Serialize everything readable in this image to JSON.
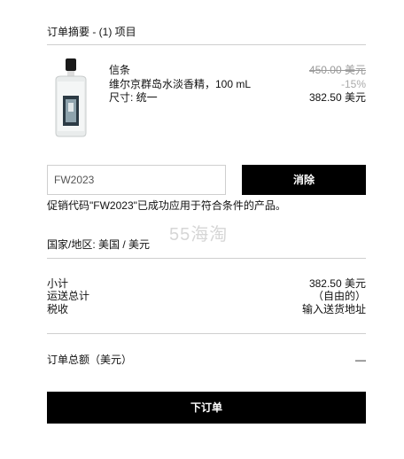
{
  "summary": {
    "title": "订单摘要 - (1) 项目"
  },
  "item": {
    "name": "信条",
    "description": "维尔京群岛水淡香精，100 mL",
    "size": "尺寸: 统一",
    "original_price": "450.00 美元",
    "discount": "-15%",
    "final_price": "382.50 美元"
  },
  "promo": {
    "code_value": "FW2023",
    "remove_label": "消除",
    "success_message": "促销代码\"FW2023\"已成功应用于符合条件的产品。"
  },
  "watermark": "55海淘",
  "region": {
    "label": "国家/地区: 美国 / 美元"
  },
  "totals": {
    "subtotal_label": "小计",
    "subtotal_value": "382.50 美元",
    "shipping_label": "运送总计",
    "shipping_value": "（自由的）",
    "tax_label": "税收",
    "tax_value": "输入送货地址",
    "order_total_label": "订单总额（美元）",
    "order_total_value": "—"
  },
  "checkout": {
    "place_order_label": "下订单"
  }
}
